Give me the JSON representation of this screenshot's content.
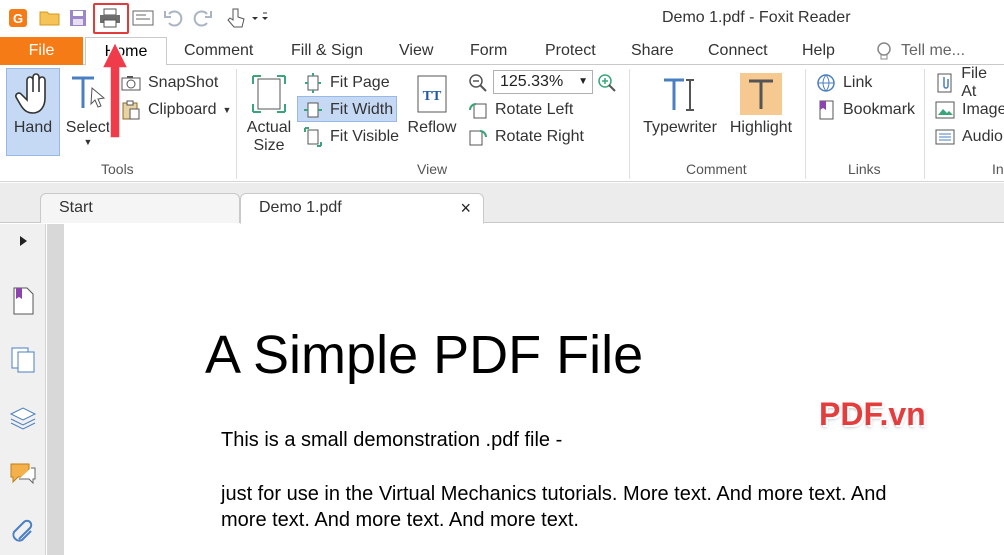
{
  "window": {
    "title": "Demo 1.pdf - Foxit Reader"
  },
  "quick_access": [
    "app-icon",
    "open-icon",
    "save-icon",
    "print-icon",
    "display-icon",
    "undo-icon",
    "redo-icon",
    "touch-icon"
  ],
  "tabs": [
    "File",
    "Home",
    "Comment",
    "Fill & Sign",
    "View",
    "Form",
    "Protect",
    "Share",
    "Connect",
    "Help"
  ],
  "tell_me": {
    "placeholder": "Tell me..."
  },
  "ribbon": {
    "tools": {
      "label": "Tools",
      "hand": "Hand",
      "select": "Select",
      "snapshot": "SnapShot",
      "clipboard": "Clipboard"
    },
    "view": {
      "label": "View",
      "actual_size_line1": "Actual",
      "actual_size_line2": "Size",
      "fit_page": "Fit Page",
      "fit_width": "Fit Width",
      "fit_visible": "Fit Visible",
      "reflow": "Reflow",
      "zoom": "125.33%",
      "rotate_left": "Rotate Left",
      "rotate_right": "Rotate Right"
    },
    "comment": {
      "label": "Comment",
      "typewriter": "Typewriter",
      "highlight": "Highlight"
    },
    "links": {
      "label": "Links",
      "link": "Link",
      "bookmark": "Bookmark"
    },
    "insert": {
      "label": "In",
      "file_attachment": "File At",
      "image": "Image",
      "audio": "Audio"
    }
  },
  "doc_tabs": [
    {
      "label": "Start"
    },
    {
      "label": "Demo 1.pdf",
      "close": "×"
    }
  ],
  "document": {
    "title": "A Simple PDF File",
    "line1": "This is a small demonstration .pdf file -",
    "line2": "just for use in the Virtual Mechanics tutorials. More text. And more text. And more text. And more text. And more text."
  },
  "watermark": "PDF.vn",
  "colors": {
    "file_tab": "#f47b16",
    "annotation": "#e23b3b",
    "selected": "#c5d9f5"
  }
}
